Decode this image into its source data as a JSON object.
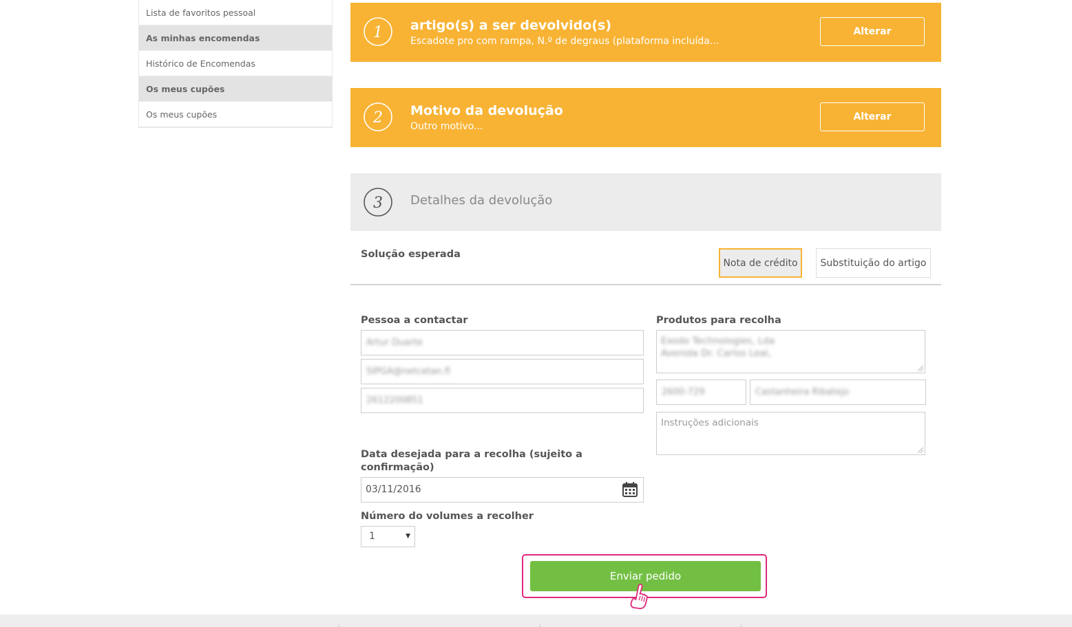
{
  "sidebar": {
    "items": [
      {
        "label": "Lista de favoritos pessoal",
        "type": "item"
      },
      {
        "label": "As minhas encomendas",
        "type": "head"
      },
      {
        "label": "Histórico de Encomendas",
        "type": "item"
      },
      {
        "label": "Os meus cupões",
        "type": "head"
      },
      {
        "label": "Os meus cupões",
        "type": "item"
      }
    ]
  },
  "steps": [
    {
      "number": "1",
      "title": "artigo(s) a ser devolvido(s)",
      "subtitle": "Escadote pro com rampa, N.º de degraus (plataforma incluída...",
      "button": "Alterar"
    },
    {
      "number": "2",
      "title": "Motivo da devolução",
      "subtitle": "Outro motivo...",
      "button": "Alterar"
    },
    {
      "number": "3",
      "title": "Detalhes da devolução"
    }
  ],
  "solution": {
    "label": "Solução esperada",
    "options": [
      "Nota de crédito",
      "Substituição do artigo"
    ],
    "selected": "Nota de crédito"
  },
  "contact": {
    "label": "Pessoa a contactar",
    "name": "Artur Duarte",
    "email": "SIPGA@netcetan.fl",
    "phone": "2612200851"
  },
  "pickup": {
    "label": "Produtos para recolha",
    "address_line1": "Exodo Technologies, Lda",
    "address_line2": "Avenida Dr. Carlos Leal,",
    "postal_code": "2600-729",
    "city": "Castanheira Ribatejo",
    "instructions_placeholder": "Instruções adicionais"
  },
  "date": {
    "label": "Data desejada para a recolha (sujeito a confirmação)",
    "value": "03/11/2016"
  },
  "volumes": {
    "label": "Número do volumes a recolher",
    "value": "1"
  },
  "submit_label": "Enviar pedido",
  "colors": {
    "accent_orange": "#f8b334",
    "submit_green": "#73bf44",
    "highlight_pink": "#e0287a"
  }
}
